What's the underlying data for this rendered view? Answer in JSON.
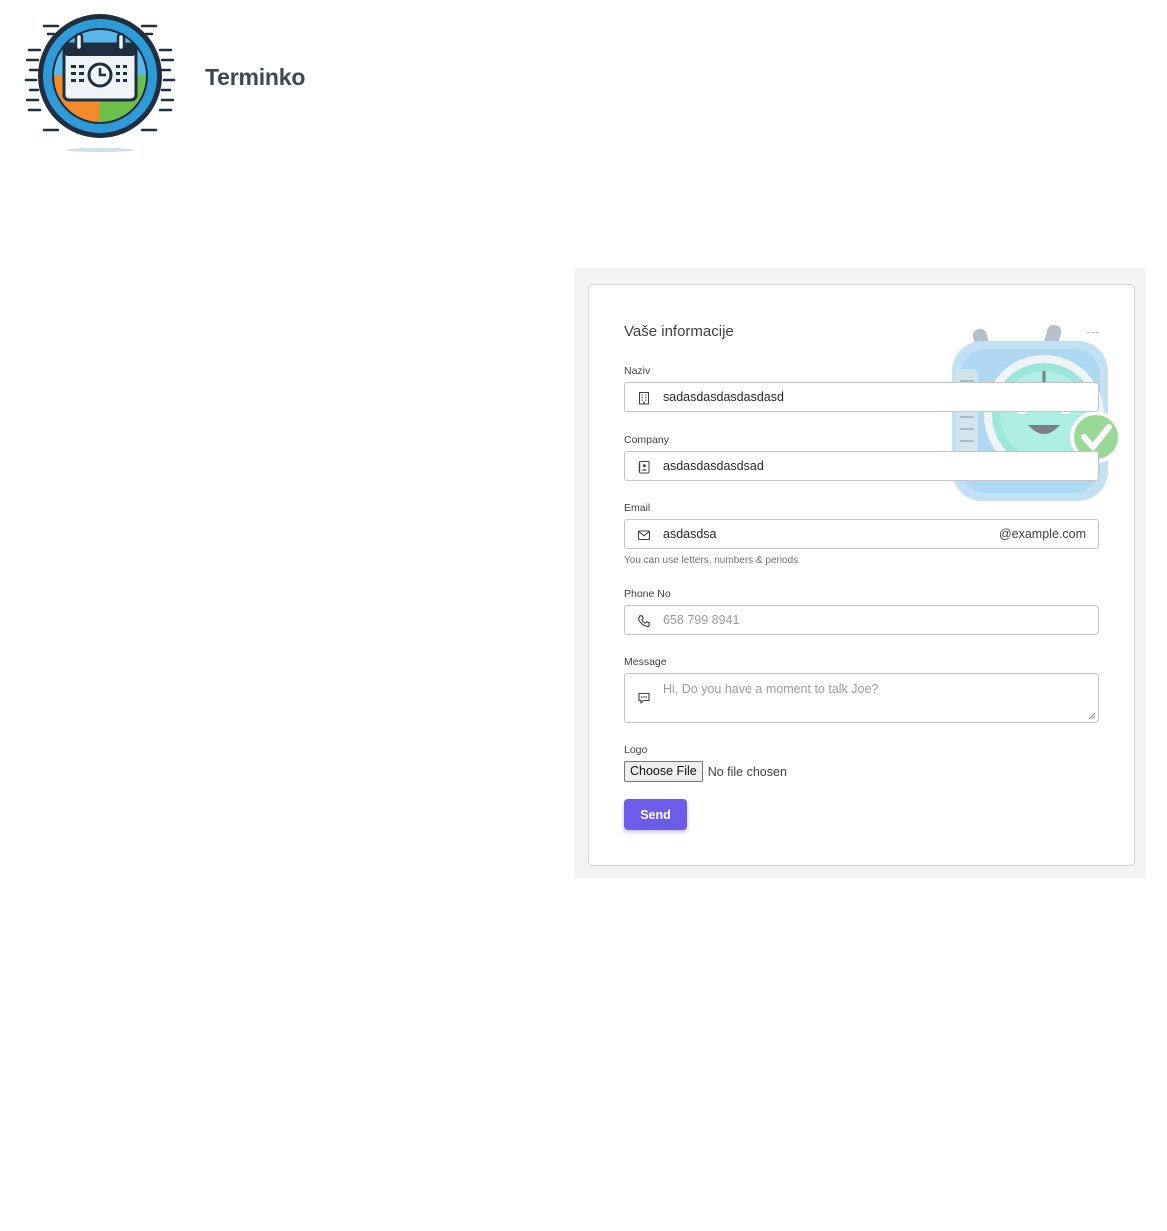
{
  "brand": {
    "name": "Terminko"
  },
  "form": {
    "title": "Vaše informacije",
    "naziv": {
      "label": "Naziv",
      "value": "sadasdasdasdasdasd"
    },
    "company": {
      "label": "Company",
      "value": "asdasdasdasdsad"
    },
    "email": {
      "label": "Email",
      "value": "asdasdsa",
      "suffix": "@example.com",
      "hint": "You can use letters, numbers & periods"
    },
    "phone": {
      "label": "Phone No",
      "placeholder": "658 799 8941"
    },
    "message": {
      "label": "Message",
      "placeholder": "Hi, Do you have a moment to talk Joe?"
    },
    "logo": {
      "label": "Logo",
      "button_label": "Choose File",
      "status": "No file chosen"
    },
    "send_label": "Send"
  },
  "colors": {
    "accent": "#6d5ce8",
    "panel_bg": "#f4f4f5",
    "brand_text": "#3f4654"
  }
}
